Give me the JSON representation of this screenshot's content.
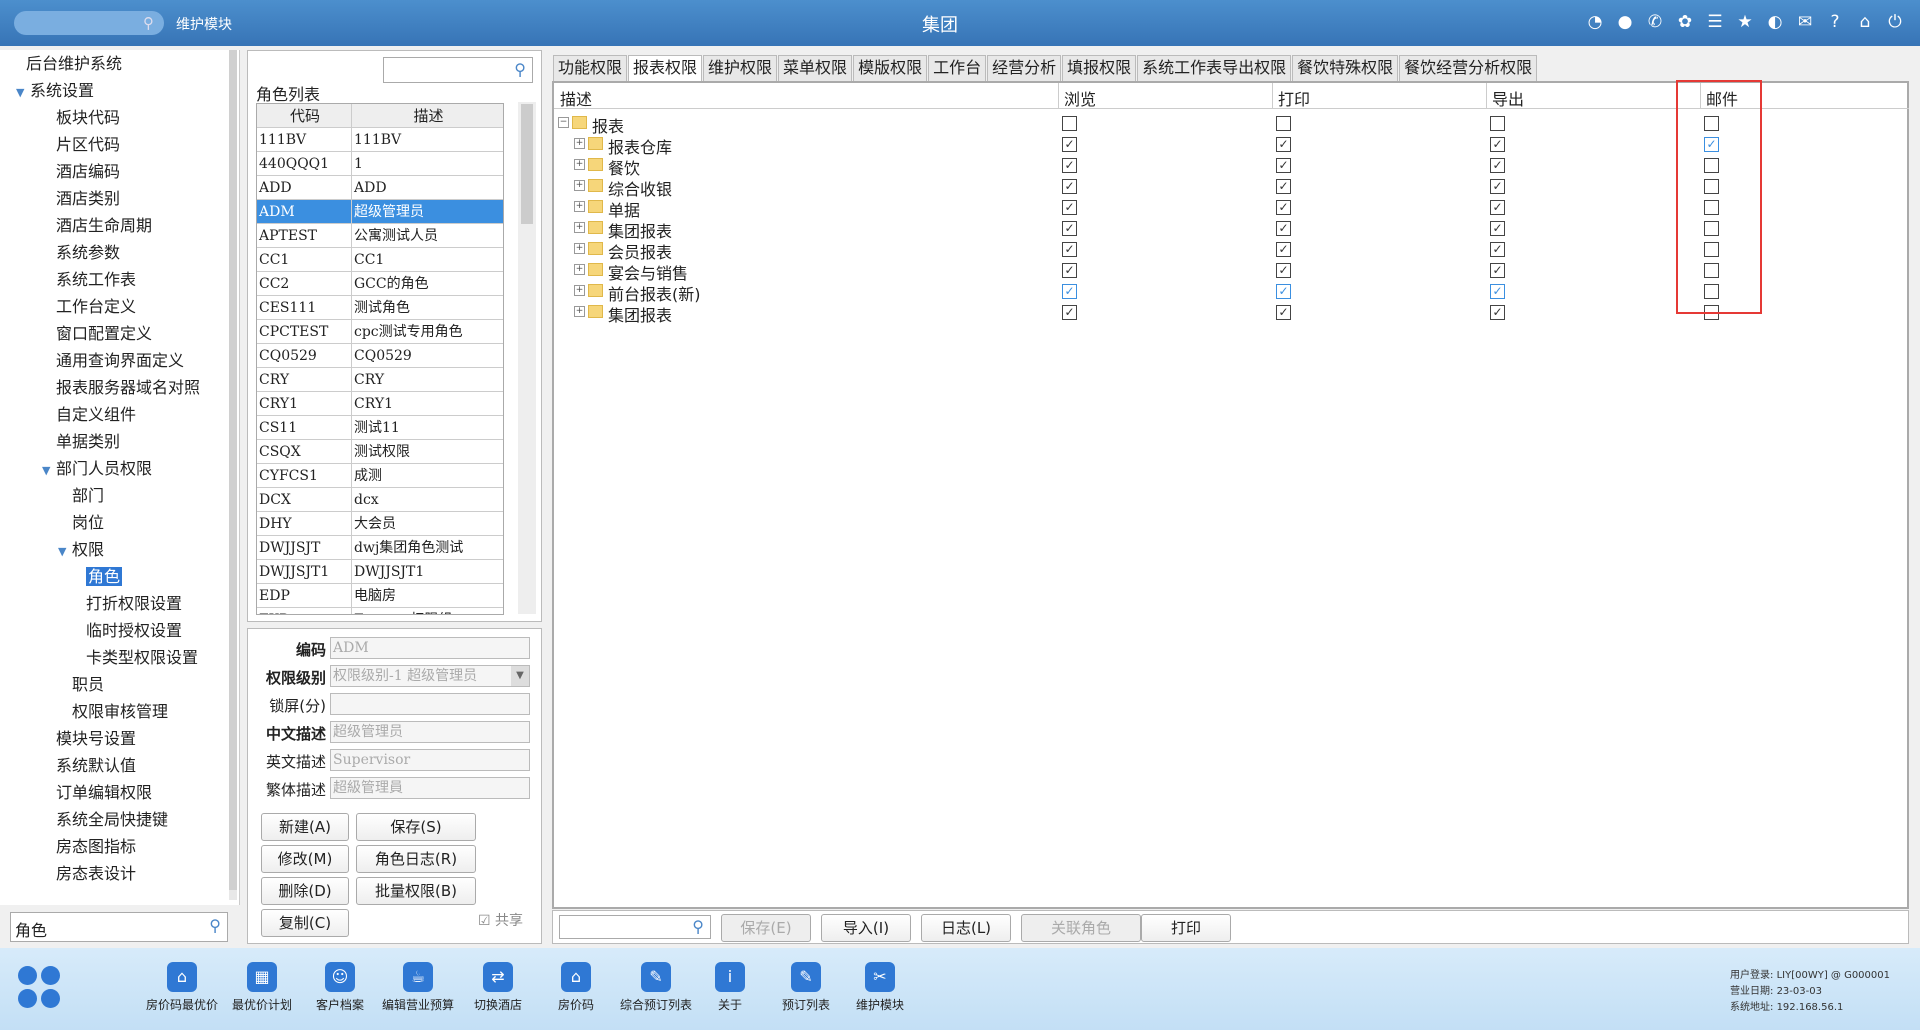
{
  "topbar": {
    "module": "维护模块",
    "title": "集团",
    "search_placeholder": ""
  },
  "nav": {
    "items": [
      {
        "label": "后台维护系统",
        "lv": 0,
        "caret": ""
      },
      {
        "label": "系统设置",
        "lv": 1,
        "caret": "▼"
      },
      {
        "label": "板块代码",
        "lv": 2,
        "caret": ""
      },
      {
        "label": "片区代码",
        "lv": 2,
        "caret": ""
      },
      {
        "label": "酒店编码",
        "lv": 2,
        "caret": ""
      },
      {
        "label": "酒店类别",
        "lv": 2,
        "caret": ""
      },
      {
        "label": "酒店生命周期",
        "lv": 2,
        "caret": ""
      },
      {
        "label": "系统参数",
        "lv": 2,
        "caret": ""
      },
      {
        "label": "系统工作表",
        "lv": 2,
        "caret": ""
      },
      {
        "label": "工作台定义",
        "lv": 2,
        "caret": ""
      },
      {
        "label": "窗口配置定义",
        "lv": 2,
        "caret": ""
      },
      {
        "label": "通用查询界面定义",
        "lv": 2,
        "caret": ""
      },
      {
        "label": "报表服务器域名对照",
        "lv": 2,
        "caret": ""
      },
      {
        "label": "自定义组件",
        "lv": 2,
        "caret": ""
      },
      {
        "label": "单据类别",
        "lv": 2,
        "caret": ""
      },
      {
        "label": "部门人员权限",
        "lv": 2,
        "caret": "▼"
      },
      {
        "label": "部门",
        "lv": 3,
        "caret": ""
      },
      {
        "label": "岗位",
        "lv": 3,
        "caret": ""
      },
      {
        "label": "权限",
        "lv": 3,
        "caret": "▼"
      },
      {
        "label": "角色",
        "lv": 4,
        "caret": "",
        "sel": true
      },
      {
        "label": "打折权限设置",
        "lv": 4,
        "caret": ""
      },
      {
        "label": "临时授权设置",
        "lv": 4,
        "caret": ""
      },
      {
        "label": "卡类型权限设置",
        "lv": 4,
        "caret": ""
      },
      {
        "label": "职员",
        "lv": 3,
        "caret": ""
      },
      {
        "label": "权限审核管理",
        "lv": 3,
        "caret": ""
      },
      {
        "label": "模块号设置",
        "lv": 2,
        "caret": ""
      },
      {
        "label": "系统默认值",
        "lv": 2,
        "caret": ""
      },
      {
        "label": "订单编辑权限",
        "lv": 2,
        "caret": ""
      },
      {
        "label": "系统全局快捷键",
        "lv": 2,
        "caret": ""
      },
      {
        "label": "房态图指标",
        "lv": 2,
        "caret": ""
      },
      {
        "label": "房态表设计",
        "lv": 2,
        "caret": ""
      },
      {
        "label": "",
        "lv": 2,
        "caret": ""
      }
    ],
    "search_value": "角色"
  },
  "roles": {
    "title": "角色列表",
    "col_code": "代码",
    "col_desc": "描述",
    "rows": [
      [
        "111BV",
        "111BV"
      ],
      [
        "440QQQ1",
        "1"
      ],
      [
        "ADD",
        "ADD"
      ],
      [
        "ADM",
        "超级管理员"
      ],
      [
        "APTEST",
        "公寓测试人员"
      ],
      [
        "CC1",
        "CC1"
      ],
      [
        "CC2",
        "GCC的角色"
      ],
      [
        "CES111",
        "测试角色"
      ],
      [
        "CPCTEST",
        "cpc测试专用角色"
      ],
      [
        "CQ0529",
        "CQ0529"
      ],
      [
        "CRY",
        "CRY"
      ],
      [
        "CRY1",
        "CRY1"
      ],
      [
        "CS11",
        "测试11"
      ],
      [
        "CSQX",
        "测试权限"
      ],
      [
        "CYFCS1",
        "成测"
      ],
      [
        "DCX",
        "dcx"
      ],
      [
        "DHY",
        "大会员"
      ],
      [
        "DWJJSJT",
        "dwj集团角色测试"
      ],
      [
        "DWJJSJT1",
        "DWJJSJT1"
      ],
      [
        "EDP",
        "电脑房"
      ],
      [
        "EXP",
        "Express权限组"
      ]
    ],
    "selected": 3
  },
  "detail": {
    "f_code": "编码",
    "v_code": "ADM",
    "f_level": "权限级别",
    "v_level": "权限级别-1 超级管理员",
    "f_lock": "锁屏(分)",
    "v_lock": "",
    "f_cn": "中文描述",
    "v_cn": "超级管理员",
    "f_en": "英文描述",
    "v_en": "Supervisor",
    "f_tw": "繁体描述",
    "v_tw": "超級管理員",
    "b_new": "新建(A)",
    "b_save": "保存(S)",
    "b_edit": "修改(M)",
    "b_log": "角色日志(R)",
    "b_del": "删除(D)",
    "b_batch": "批量权限(B)",
    "b_copy": "复制(C)",
    "share": "☑ 共享"
  },
  "tabs": [
    "功能权限",
    "报表权限",
    "维护权限",
    "菜单权限",
    "模版权限",
    "工作台",
    "经营分析",
    "填报权限",
    "系统工作表导出权限",
    "餐饮特殊权限",
    "餐饮经营分析权限"
  ],
  "active_tab": 1,
  "grid": {
    "h_desc": "描述",
    "h_view": "浏览",
    "h_print": "打印",
    "h_export": "导出",
    "h_mail": "邮件",
    "rows": [
      {
        "name": "报表",
        "root": true,
        "v": "",
        "p": "",
        "e": "",
        "m": ""
      },
      {
        "name": "报表仓库",
        "v": "✓",
        "p": "✓",
        "e": "✓",
        "m": "✓",
        "mb": true
      },
      {
        "name": "餐饮",
        "v": "✓",
        "p": "✓",
        "e": "✓",
        "m": ""
      },
      {
        "name": "综合收银",
        "v": "✓",
        "p": "✓",
        "e": "✓",
        "m": ""
      },
      {
        "name": "单据",
        "v": "✓",
        "p": "✓",
        "e": "✓",
        "m": ""
      },
      {
        "name": "集团报表",
        "v": "✓",
        "p": "✓",
        "e": "✓",
        "m": ""
      },
      {
        "name": "会员报表",
        "v": "✓",
        "p": "✓",
        "e": "✓",
        "m": ""
      },
      {
        "name": "宴会与销售",
        "v": "✓",
        "p": "✓",
        "e": "✓",
        "m": ""
      },
      {
        "name": "前台报表(新)",
        "v": "✓",
        "p": "✓",
        "e": "✓",
        "m": "",
        "blue": true
      },
      {
        "name": "集团报表",
        "v": "✓",
        "p": "✓",
        "e": "✓",
        "m": ""
      }
    ]
  },
  "bottom": {
    "b_save": "保存(E)",
    "b_import": "导入(I)",
    "b_log": "日志(L)",
    "b_link": "关联角色",
    "b_print": "打印"
  },
  "footer": {
    "items": [
      {
        "label": "房价码最优价",
        "icon": "⌂"
      },
      {
        "label": "最优价计划",
        "icon": "▦"
      },
      {
        "label": "客户档案",
        "icon": "☺"
      },
      {
        "label": "编辑营业预算",
        "icon": "☕"
      },
      {
        "label": "切换酒店",
        "icon": "⇄"
      },
      {
        "label": "房价码",
        "icon": "⌂"
      },
      {
        "label": "综合预订列表",
        "icon": "✎"
      },
      {
        "label": "关于",
        "icon": "i"
      },
      {
        "label": "预订列表",
        "icon": "✎"
      },
      {
        "label": "维护模块",
        "icon": "✂"
      }
    ],
    "user": "用户登录: LIY[00WY] @ G000001",
    "date": "营业日期: 23-03-03",
    "ip": "系统地址: 192.168.56.1"
  }
}
